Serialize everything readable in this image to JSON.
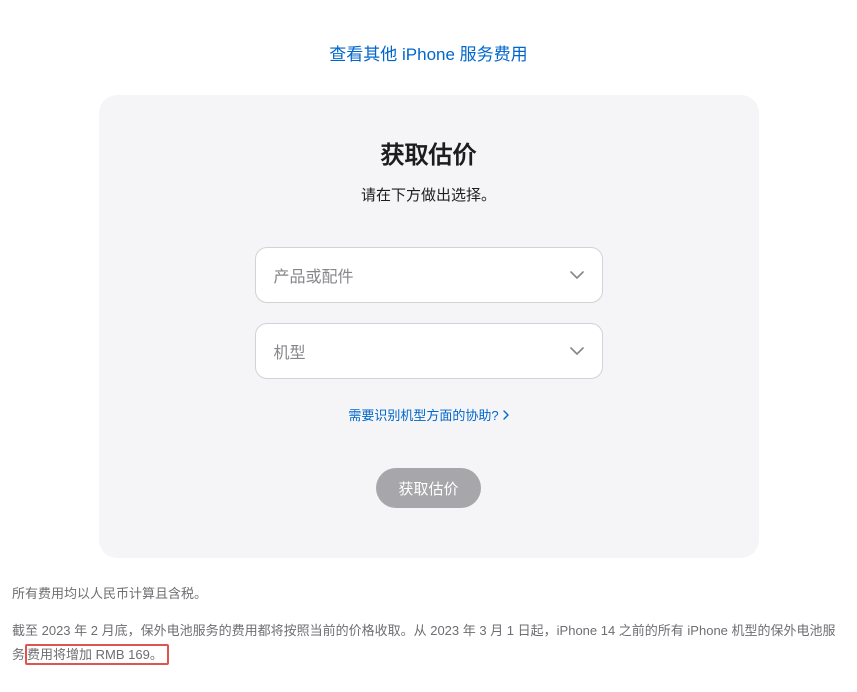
{
  "topLink": {
    "label": "查看其他 iPhone 服务费用"
  },
  "card": {
    "title": "获取估价",
    "subtitle": "请在下方做出选择。",
    "select1": {
      "placeholder": "产品或配件"
    },
    "select2": {
      "placeholder": "机型"
    },
    "helpLink": "需要识别机型方面的协助?",
    "submitLabel": "获取估价"
  },
  "footnotes": {
    "line1": "所有费用均以人民币计算且含税。",
    "line2_prefix": "截至 2023 年 2 月底，保外电池服务的费用都将按照当前的价格收取。从 2023 年 3 月 1 日起，iPhone 14 之前的所有 iPhone 机型的保外电池服务",
    "line2_highlight": "费用将增加 RMB 169。"
  }
}
